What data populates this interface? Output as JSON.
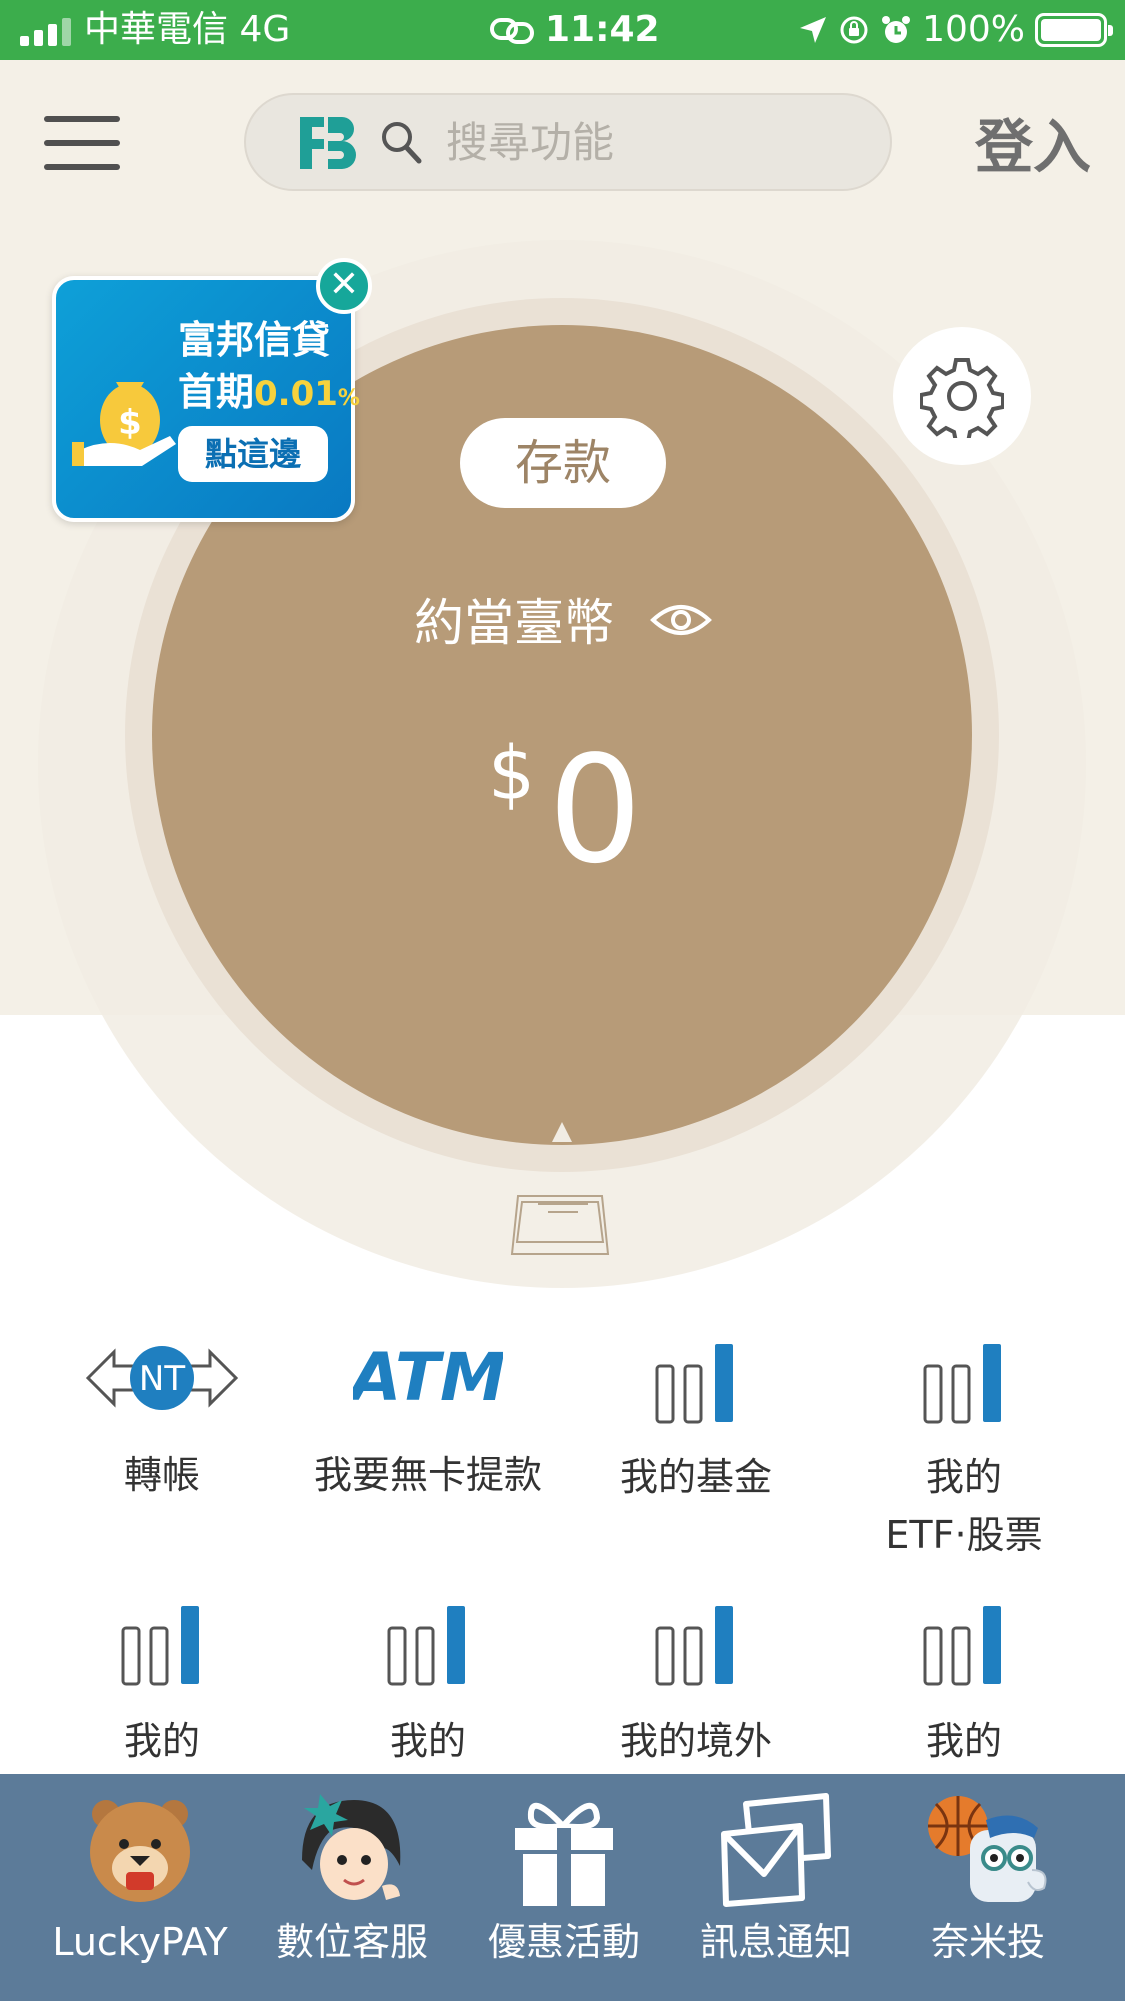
{
  "status_bar": {
    "carrier": "中華電信  4G",
    "time": "11:42",
    "battery": "100%",
    "battery_level": 1.0
  },
  "header": {
    "search_placeholder": "搜尋功能",
    "login_label": "登入"
  },
  "promo": {
    "line1": "富邦信貸",
    "line2_prefix": "首期",
    "rate": "0.01",
    "rate_unit": "%",
    "cta": "點這邊"
  },
  "account": {
    "type_tab": "存款",
    "balance_label": "約當臺幣",
    "currency_symbol": "$",
    "balance": "0"
  },
  "features": [
    {
      "label": "轉帳",
      "icon": "nt-transfer-icon"
    },
    {
      "label": "我要無卡提款",
      "icon": "atm-icon",
      "icon_text": "ATM"
    },
    {
      "label": "我的基金",
      "icon": "bar-chart-icon"
    },
    {
      "label": "我的\nETF‧股票",
      "icon": "bar-chart-icon"
    },
    {
      "label": "我的",
      "icon": "bar-chart-icon"
    },
    {
      "label": "我的",
      "icon": "bar-chart-icon"
    },
    {
      "label": "我的境外",
      "icon": "bar-chart-icon"
    },
    {
      "label": "我的",
      "icon": "bar-chart-icon"
    }
  ],
  "nt_icon_text": "NT",
  "tabbar": [
    {
      "label": "LuckyPAY",
      "icon": "bear-mascot-icon"
    },
    {
      "label": "數位客服",
      "icon": "service-girl-icon"
    },
    {
      "label": "優惠活動",
      "icon": "gift-icon"
    },
    {
      "label": "訊息通知",
      "icon": "envelope-icon"
    },
    {
      "label": "奈米投",
      "icon": "basketball-robot-icon"
    }
  ],
  "colors": {
    "status_green": "#3cad4c",
    "header_beige": "#f4f0e7",
    "disc_brown": "#b79b78",
    "accent_blue": "#1f7fc0",
    "tabbar_blue": "#5c7b99",
    "promo_blue": "#0ea0d8"
  }
}
